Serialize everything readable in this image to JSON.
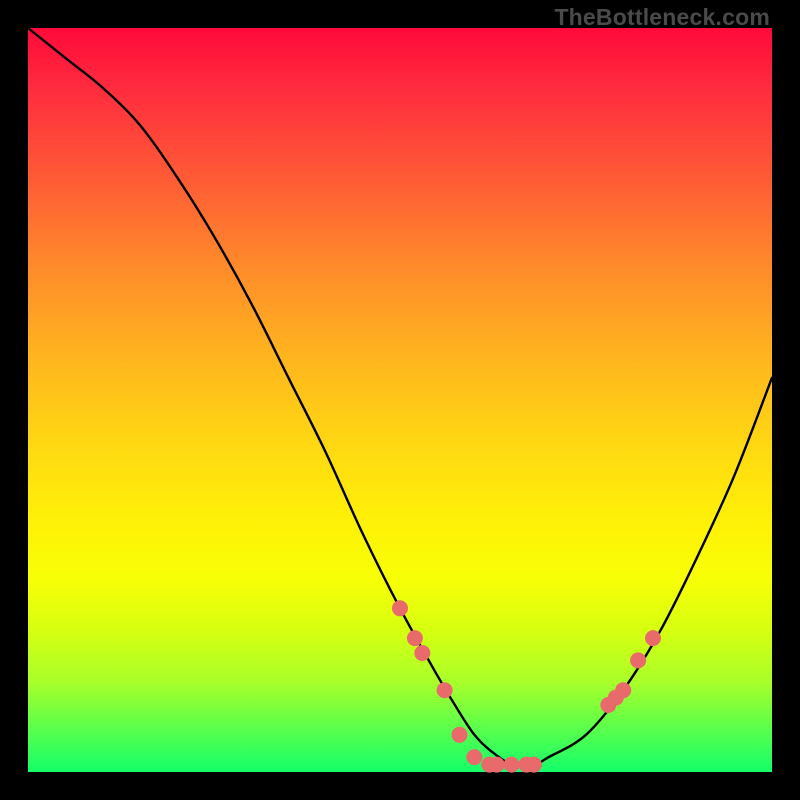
{
  "watermark": "TheBottleneck.com",
  "chart_data": {
    "type": "line",
    "title": "",
    "xlabel": "",
    "ylabel": "",
    "xlim": [
      0,
      100
    ],
    "ylim": [
      0,
      100
    ],
    "series": [
      {
        "name": "bottleneck-curve",
        "x": [
          0,
          5,
          10,
          15,
          20,
          25,
          30,
          35,
          40,
          45,
          50,
          55,
          58,
          60,
          62,
          65,
          68,
          70,
          75,
          80,
          85,
          90,
          95,
          100
        ],
        "y": [
          100,
          96,
          92,
          87,
          80,
          72,
          63,
          53,
          43,
          32,
          22,
          13,
          8,
          5,
          3,
          1,
          1,
          2,
          5,
          11,
          19,
          29,
          40,
          53
        ]
      }
    ],
    "markers": {
      "name": "highlight-dots",
      "color": "#e86a6a",
      "radius_px": 8,
      "x": [
        50,
        52,
        53,
        56,
        58,
        60,
        62,
        63,
        65,
        67,
        68,
        78,
        79,
        80,
        82,
        84
      ],
      "y": [
        22,
        18,
        16,
        11,
        5,
        2,
        1,
        1,
        1,
        1,
        1,
        9,
        10,
        11,
        15,
        18
      ]
    }
  }
}
